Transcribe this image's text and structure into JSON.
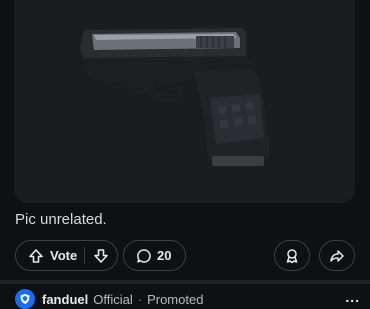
{
  "post": {
    "caption": "Pic unrelated.",
    "vote_label": "Vote",
    "comment_count": "20"
  },
  "promo": {
    "brand": "fanduel",
    "badge": "Official",
    "separator": "·",
    "status": "Promoted",
    "more": "..."
  },
  "icons": {
    "upvote": "arrow-up-icon",
    "downvote": "arrow-down-icon",
    "comment": "comment-bubble-icon",
    "award": "award-icon",
    "share": "share-icon",
    "avatar": "fanduel-shield-logo"
  },
  "colors": {
    "background": "#0e1113",
    "card": "#1a1d20",
    "text": "#d7dadc",
    "pill_border": "#3a4045",
    "avatar_blue": "#1c6cf2"
  }
}
